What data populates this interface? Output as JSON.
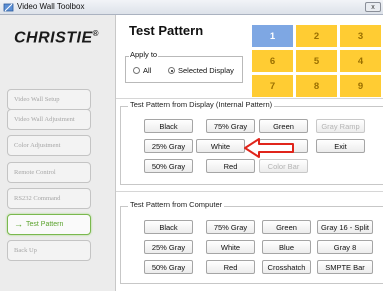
{
  "window": {
    "title": "Video Wall Toolbox",
    "close_label": "x"
  },
  "logo": {
    "text": "CHRISTIE",
    "reg": "®"
  },
  "sidebar": {
    "items": [
      {
        "label": "Video Wall Setup",
        "enabled": false,
        "active": false
      },
      {
        "label": "Video Wall Adjustment",
        "enabled": false,
        "active": false
      },
      {
        "label": "Color Adjustment",
        "enabled": false,
        "active": false
      },
      {
        "label": "Remote Control",
        "enabled": false,
        "active": false
      },
      {
        "label": "RS232 Command",
        "enabled": false,
        "active": false
      },
      {
        "label": "Test Pattern",
        "enabled": true,
        "active": true
      },
      {
        "label": "Back Up",
        "enabled": false,
        "active": false
      }
    ],
    "active_arrow": "→"
  },
  "main": {
    "title": "Test Pattern"
  },
  "apply_to": {
    "label": "Apply to",
    "options": [
      {
        "label": "All",
        "selected": false
      },
      {
        "label": "Selected Display",
        "selected": true
      }
    ]
  },
  "display_grid": {
    "cells": [
      {
        "label": "1",
        "color": "#7ea7e3"
      },
      {
        "label": "2",
        "color": "#ffcc33"
      },
      {
        "label": "3",
        "color": "#ffcc33"
      },
      {
        "label": "6",
        "color": "#ffcc33"
      },
      {
        "label": "5",
        "color": "#ffcc33"
      },
      {
        "label": "4",
        "color": "#ffcc33"
      },
      {
        "label": "7",
        "color": "#ffcc33"
      },
      {
        "label": "8",
        "color": "#ffcc33"
      },
      {
        "label": "9",
        "color": "#ffcc33"
      }
    ]
  },
  "internal_section": {
    "label": "Test Pattern from Display (Internal Pattern)",
    "buttons": [
      {
        "label": "Black",
        "enabled": true
      },
      {
        "label": "75% Gray",
        "enabled": true
      },
      {
        "label": "Green",
        "enabled": true
      },
      {
        "label": "Gray Ramp",
        "enabled": false
      },
      {
        "label": "25% Gray",
        "enabled": true
      },
      {
        "label": "White",
        "enabled": true
      },
      {
        "label": "Blue",
        "enabled": true
      },
      {
        "label": "Exit",
        "enabled": true
      },
      {
        "label": "50% Gray",
        "enabled": true
      },
      {
        "label": "Red",
        "enabled": true
      },
      {
        "label": "Color Bar",
        "enabled": false
      }
    ]
  },
  "computer_section": {
    "label": "Test Pattern from Computer",
    "buttons": [
      {
        "label": "Black"
      },
      {
        "label": "75% Gray"
      },
      {
        "label": "Green"
      },
      {
        "label": "Gray 16 - Split"
      },
      {
        "label": "25% Gray"
      },
      {
        "label": "White"
      },
      {
        "label": "Blue"
      },
      {
        "label": "Gray 8"
      },
      {
        "label": "50% Gray"
      },
      {
        "label": "Red"
      },
      {
        "label": "Crosshatch"
      },
      {
        "label": "SMPTE Bar"
      }
    ]
  },
  "annotation": {
    "icon": "red-arrow-left-icon",
    "color": "#e0251b"
  }
}
